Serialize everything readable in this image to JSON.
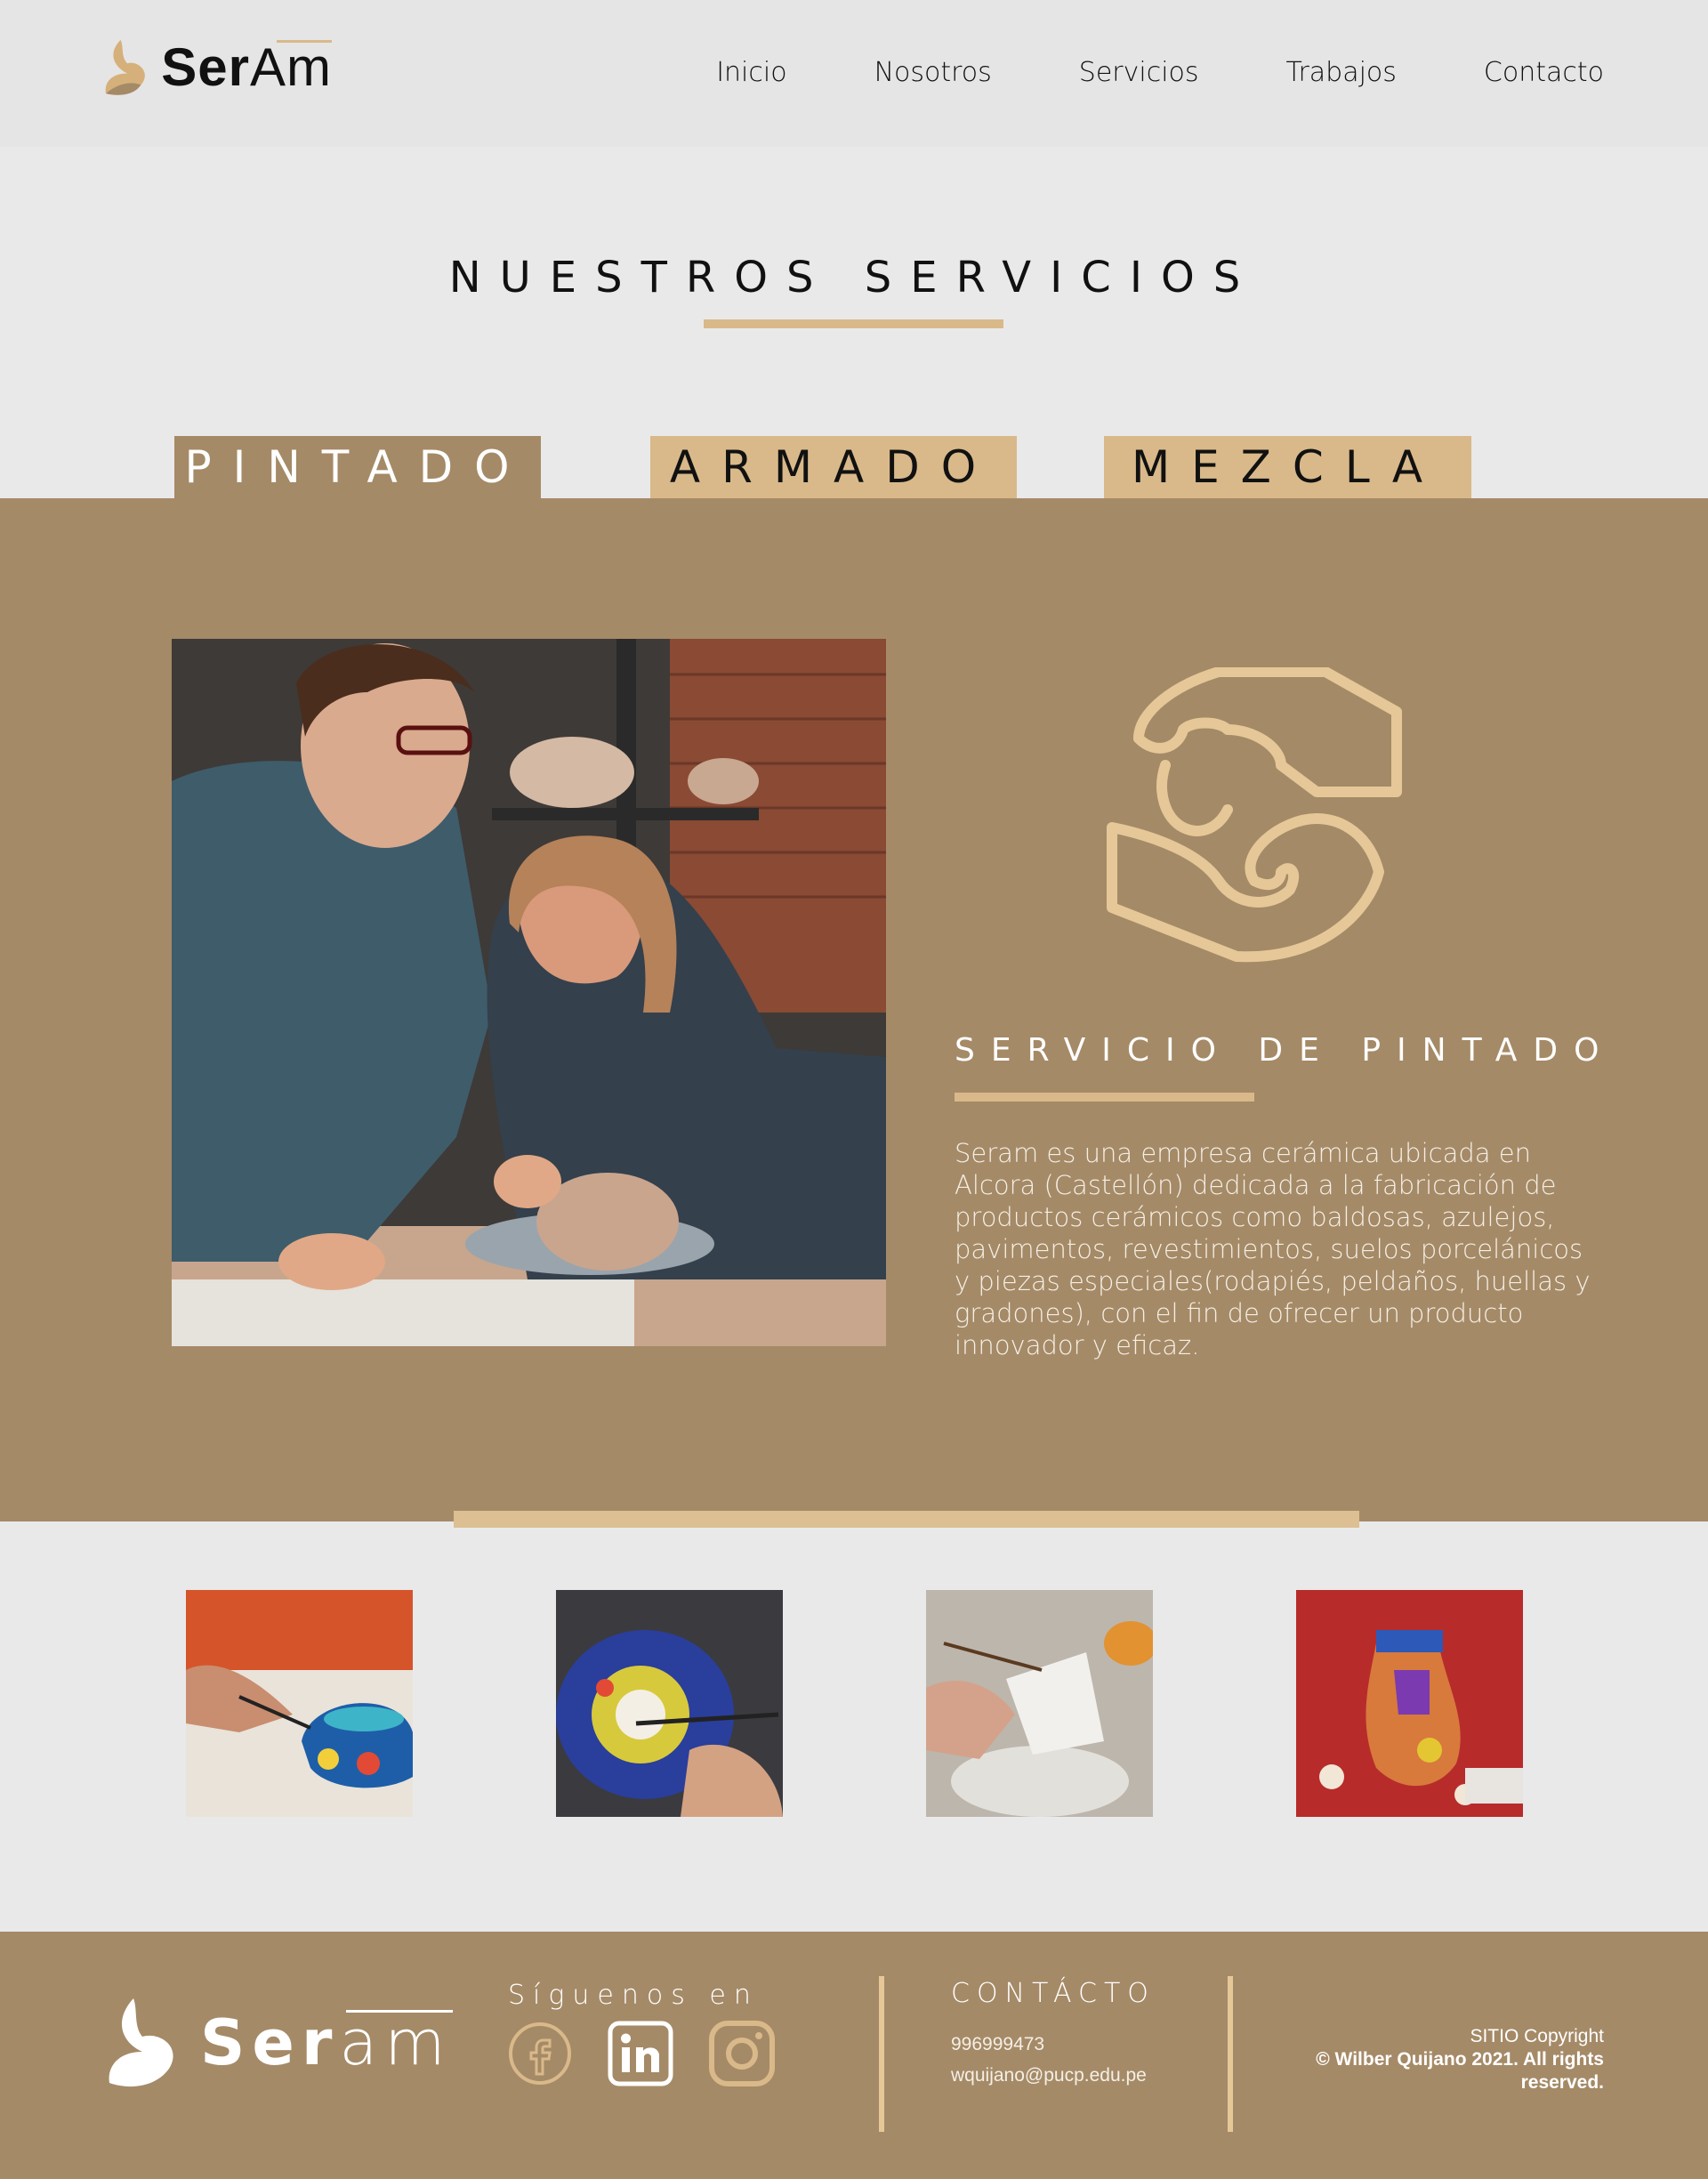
{
  "header": {
    "logo": {
      "bold": "Ser",
      "light": "Am"
    },
    "nav": [
      "Inicio",
      "Nosotros",
      "Servicios",
      "Trabajos",
      "Contacto"
    ]
  },
  "section": {
    "title": "NUESTROS SERVICIOS"
  },
  "tabs": [
    {
      "label": "PINTADO",
      "active": true
    },
    {
      "label": "ARMADO",
      "active": false
    },
    {
      "label": "MEZCLA",
      "active": false
    }
  ],
  "service": {
    "heading": "SERVICIO DE PINTADO",
    "description": "Seram es una empresa cerámica ubicada en Alcora (Castellón) dedicada a la fabricación de productos cerámicos como baldosas, azulejos, pavimentos, revestimientos, suelos porcelánicos y piezas especiales(rodapiés, peldaños, huellas y gradones), con el fin de ofrecer un producto innovador y eficaz.",
    "icon": "hands-icon"
  },
  "footer": {
    "logo": {
      "bold": "Ser",
      "light": "am"
    },
    "follow": "Síguenos en",
    "social": [
      "facebook-icon",
      "linkedin-icon",
      "instagram-icon"
    ],
    "contact": {
      "title": "CONTÁCTO",
      "phone": "996999473",
      "email": "wquijano@pucp.edu.pe"
    },
    "copyright": {
      "line1": "SITIO Copyright",
      "line2": "© Wilber Quijano 2021. All rights reserved."
    }
  },
  "colors": {
    "brand": "#a58a67",
    "accent": "#d9b98a",
    "background": "#eae9ea"
  }
}
